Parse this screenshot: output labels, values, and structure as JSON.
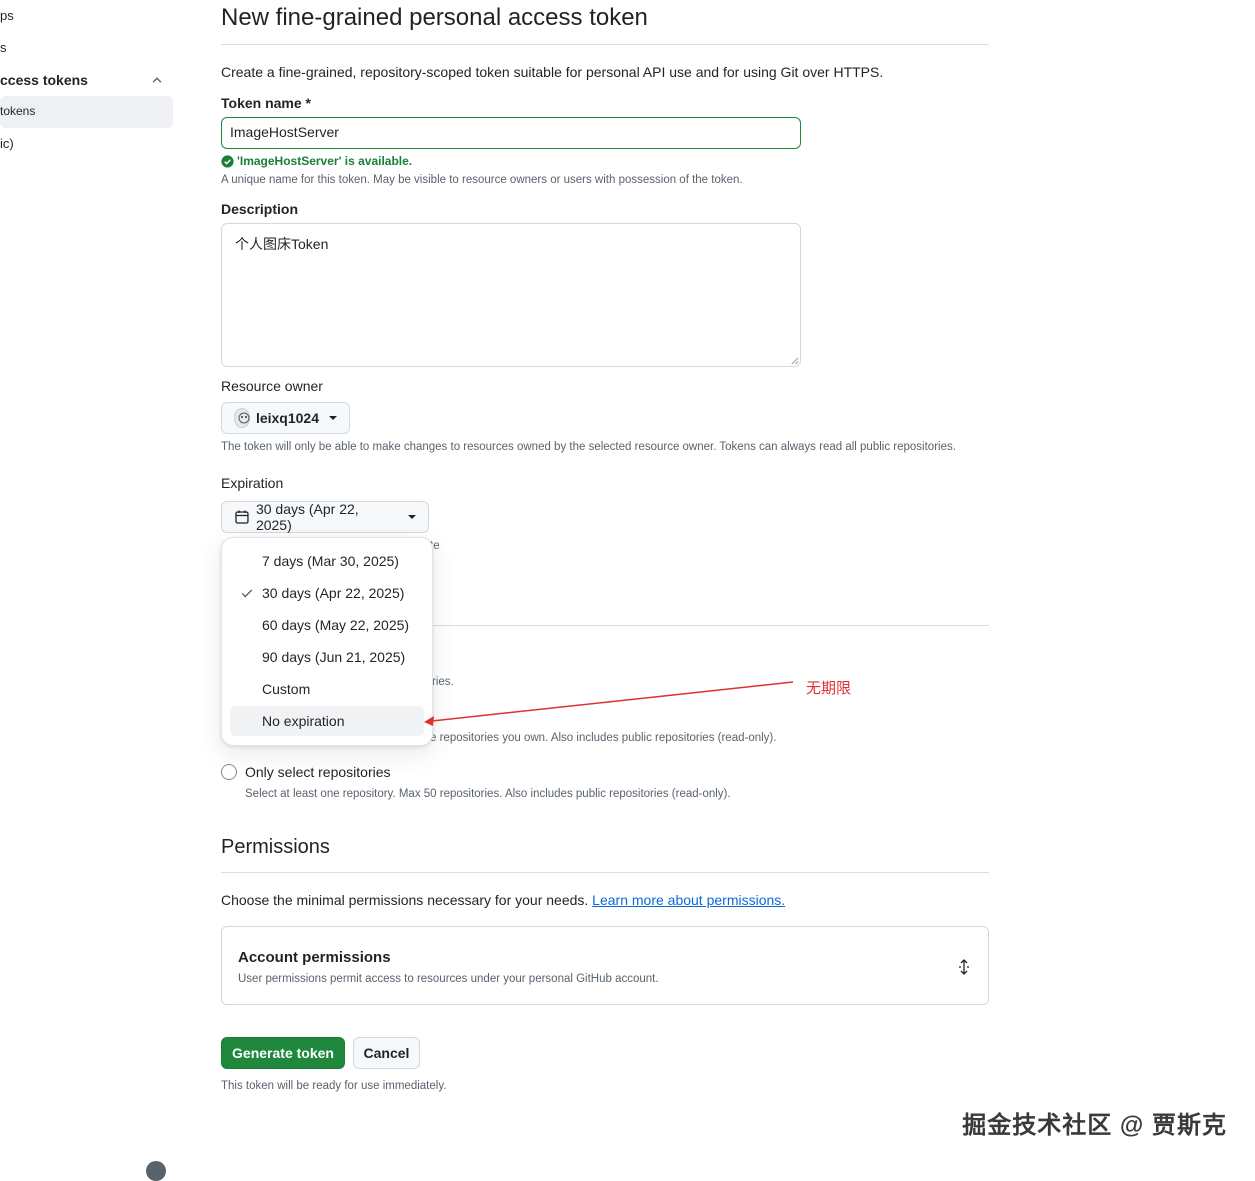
{
  "sidebar": {
    "frag1": "ps",
    "frag2": "s",
    "section": "ccess tokens",
    "active_item": "tokens",
    "frag3": "ic)"
  },
  "page": {
    "title": "New fine-grained personal access token",
    "intro": "Create a fine-grained, repository-scoped token suitable for personal API use and for using Git over HTTPS."
  },
  "token_name": {
    "label": "Token name *",
    "value": "ImageHostServer",
    "availability": "'ImageHostServer' is available.",
    "help": "A unique name for this token. May be visible to resource owners or users with possession of the token."
  },
  "description": {
    "label": "Description",
    "value": "个人图床Token"
  },
  "resource_owner": {
    "label": "Resource owner",
    "value": "leixq1024",
    "help": "The token will only be able to make changes to resources owned by the selected resource owner. Tokens can always read all public repositories."
  },
  "expiration": {
    "label": "Expiration",
    "selected": "30 days (Apr 22, 2025)",
    "behind_fragment": "te",
    "options": [
      {
        "label": "7 days (Mar 30, 2025)",
        "checked": false
      },
      {
        "label": "30 days (Apr 22, 2025)",
        "checked": true
      },
      {
        "label": "60 days (May 22, 2025)",
        "checked": false
      },
      {
        "label": "90 days (Jun 21, 2025)",
        "checked": false
      },
      {
        "label": "Custom",
        "checked": false
      },
      {
        "label": "No expiration",
        "checked": false
      }
    ]
  },
  "repository_access": {
    "frag_public": "ries.",
    "frag_all": "e repositories you own. Also includes public repositories (read-only).",
    "only_select_label": "Only select repositories",
    "only_select_help": "Select at least one repository. Max 50 repositories. Also includes public repositories (read-only)."
  },
  "permissions": {
    "heading": "Permissions",
    "intro": "Choose the minimal permissions necessary for your needs.",
    "learn_more": "Learn more about permissions.",
    "account_title": "Account permissions",
    "account_desc": "User permissions permit access to resources under your personal GitHub account."
  },
  "actions": {
    "generate": "Generate token",
    "cancel": "Cancel",
    "note": "This token will be ready for use immediately."
  },
  "annotation": {
    "text": "无期限",
    "color": "#e03030"
  },
  "watermark": "掘金技术社区 @ 贾斯克",
  "colors": {
    "primary_green": "#1f883d",
    "link_blue": "#0969da",
    "success_text": "#1a7f37"
  }
}
